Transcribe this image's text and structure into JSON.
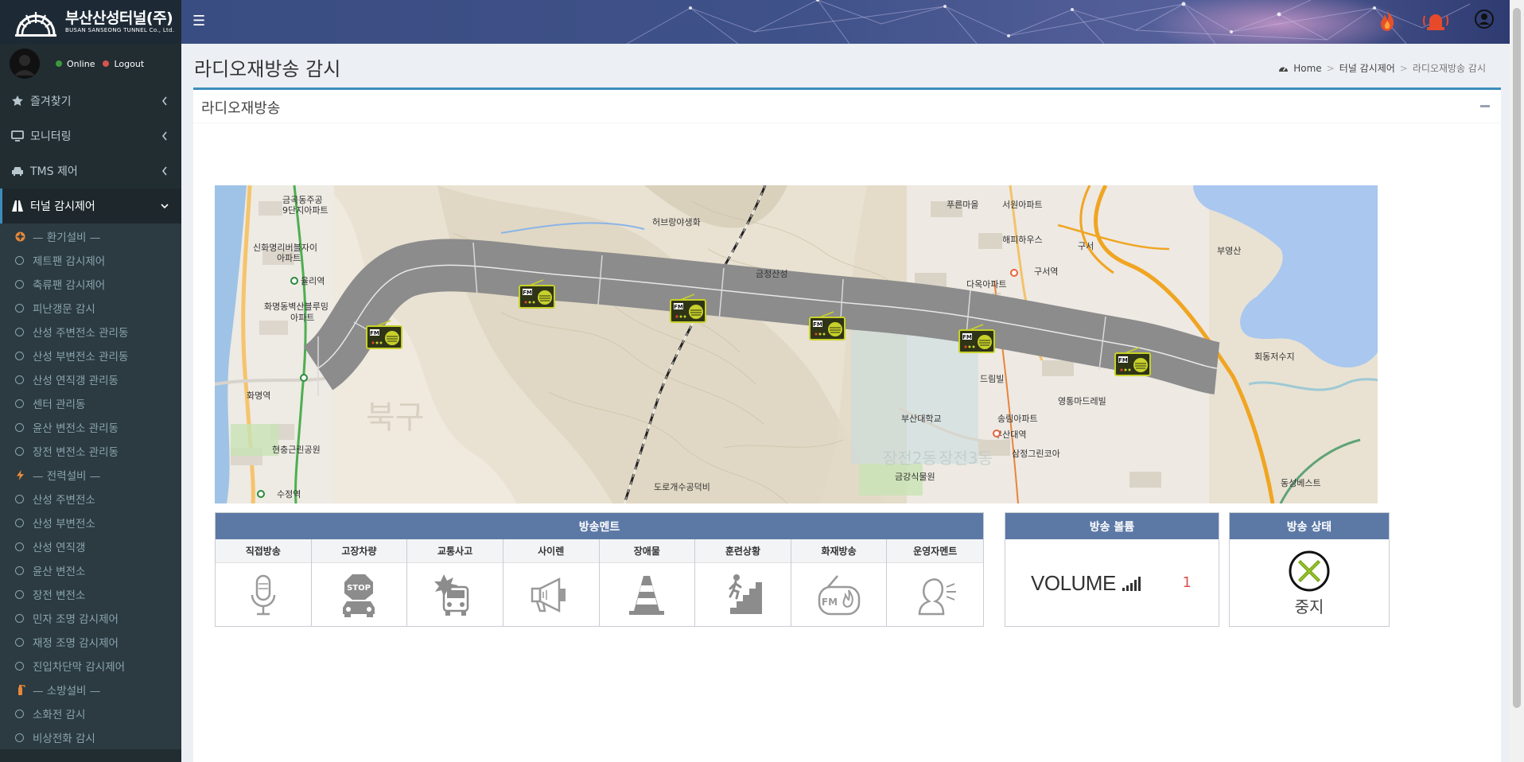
{
  "brand": {
    "name": "부산산성터널(주)",
    "sub": "BUSAN SANSEONG TUNNEL Co., Ltd."
  },
  "user": {
    "online": "Online",
    "logout": "Logout"
  },
  "menu": [
    {
      "label": "즐겨찾기",
      "icon": "star-icon"
    },
    {
      "label": "모니터링",
      "icon": "monitor-icon"
    },
    {
      "label": "TMS 제어",
      "icon": "car-icon"
    },
    {
      "label": "터널 감시제어",
      "icon": "road-icon"
    }
  ],
  "submenu": [
    {
      "label": "— 환기설비 —",
      "type": "section",
      "icon": "fan-icon",
      "color": "#e8893a"
    },
    {
      "label": "제트팬 감시제어",
      "type": "item"
    },
    {
      "label": "축류팬 감시제어",
      "type": "item"
    },
    {
      "label": "피난갱문 감시",
      "type": "item"
    },
    {
      "label": "산성 주변전소 관리동",
      "type": "item"
    },
    {
      "label": "산성 부변전소 관리동",
      "type": "item"
    },
    {
      "label": "산성 연직갱 관리동",
      "type": "item"
    },
    {
      "label": "센터 관리동",
      "type": "item"
    },
    {
      "label": "윤산 변전소 관리동",
      "type": "item"
    },
    {
      "label": "장전 변전소 관리동",
      "type": "item"
    },
    {
      "label": "— 전력설비 —",
      "type": "section",
      "icon": "bolt-icon",
      "color": "#e8893a"
    },
    {
      "label": "산성 주변전소",
      "type": "item"
    },
    {
      "label": "산성 부변전소",
      "type": "item"
    },
    {
      "label": "산성 연직갱",
      "type": "item"
    },
    {
      "label": "윤산 변전소",
      "type": "item"
    },
    {
      "label": "장전 변전소",
      "type": "item"
    },
    {
      "label": "민자 조명 감시제어",
      "type": "item"
    },
    {
      "label": "재정 조명 감시제어",
      "type": "item"
    },
    {
      "label": "진입차단막 감시제어",
      "type": "item"
    },
    {
      "label": "— 소방설비 —",
      "type": "section",
      "icon": "extinguisher-icon",
      "color": "#e8893a"
    },
    {
      "label": "소화전 감시",
      "type": "item"
    },
    {
      "label": "비상전화 감시",
      "type": "item"
    }
  ],
  "page": {
    "title": "라디오재방송 감시"
  },
  "breadcrumb": {
    "home": "Home",
    "level1": "터널 감시제어",
    "level2": "라디오재방송 감시"
  },
  "box": {
    "title": "라디오재방송"
  },
  "map_labels": [
    {
      "text": "금곡동주공"
    },
    {
      "text": "9단지아파트"
    },
    {
      "text": "신화명리버블자이"
    },
    {
      "text": "아파트"
    },
    {
      "text": "율리역"
    },
    {
      "text": "화명동벽산블루밍"
    },
    {
      "text": "아파트"
    },
    {
      "text": "화명역"
    },
    {
      "text": "현충근린공원"
    },
    {
      "text": "수정역"
    },
    {
      "text": "허브랑야생화"
    },
    {
      "text": "금정산성"
    },
    {
      "text": "도로개수공덕비"
    },
    {
      "text": "푸른마을"
    },
    {
      "text": "서원아파트"
    },
    {
      "text": "해피하우스"
    },
    {
      "text": "다옥아파트"
    },
    {
      "text": "구서역"
    },
    {
      "text": "부영산"
    },
    {
      "text": "드림빌"
    },
    {
      "text": "영통마드레빌"
    },
    {
      "text": "부산대학교"
    },
    {
      "text": "송림아파트"
    },
    {
      "text": "부산대역"
    },
    {
      "text": "삼정그린코아"
    },
    {
      "text": "금강식물원"
    },
    {
      "text": "동성베스트"
    },
    {
      "text": "회동저수지"
    },
    {
      "text": "구서"
    }
  ],
  "ments": {
    "header": "방송멘트",
    "items": [
      {
        "label": "직접방송",
        "icon": "microphone-icon"
      },
      {
        "label": "고장차량",
        "icon": "stop-car-icon"
      },
      {
        "label": "교통사고",
        "icon": "accident-icon"
      },
      {
        "label": "사이렌",
        "icon": "megaphone-icon"
      },
      {
        "label": "장애물",
        "icon": "cone-icon"
      },
      {
        "label": "훈련상황",
        "icon": "evacuation-icon"
      },
      {
        "label": "화재방송",
        "icon": "fm-fire-icon"
      },
      {
        "label": "운영자멘트",
        "icon": "operator-icon"
      }
    ]
  },
  "volume": {
    "header": "방송 볼륨",
    "label": "VOLUME",
    "value": "1"
  },
  "status": {
    "header": "방송 상태",
    "label": "중지",
    "icon": "stop-x-icon"
  }
}
